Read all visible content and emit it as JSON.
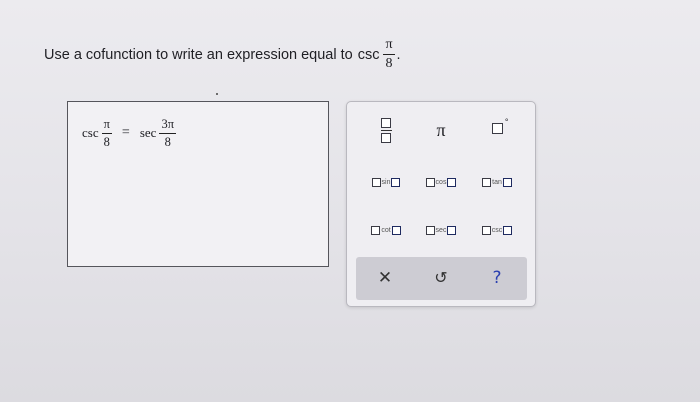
{
  "question": {
    "text": "Use a cofunction to write an expression equal to",
    "fn": "csc",
    "num": "π",
    "den": "8",
    "end": "."
  },
  "answer": {
    "left_fn": "csc",
    "left_num": "π",
    "left_den": "8",
    "eq": "=",
    "right_fn": "sec",
    "right_num": "3π",
    "right_den": "8"
  },
  "palette": {
    "pi_symbol": "π",
    "degree_symbol": "°",
    "sin": "sin",
    "cos": "cos",
    "tan": "tan",
    "cot": "cot",
    "sec": "sec",
    "csc": "csc",
    "clear": "✕",
    "undo": "↺",
    "help": "?"
  }
}
